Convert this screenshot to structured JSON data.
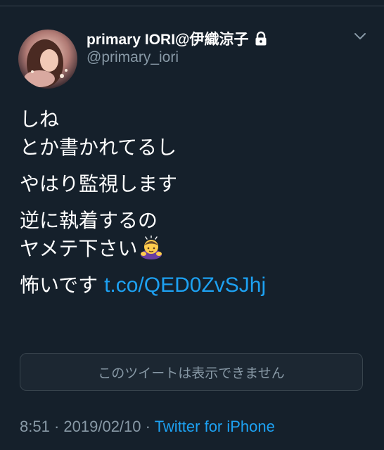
{
  "tweet": {
    "author": {
      "display_name": "primary IORI@伊織涼子",
      "handle": "@primary_iori",
      "protected": true,
      "avatar_caption": "Kiyouko Iori"
    },
    "lines": {
      "p1_l1": "しね",
      "p1_l2": "とか書かれてるし",
      "p2_l1": "やはり監視します",
      "p3_l1": "逆に執着するの",
      "p3_l2": "ヤメテ下さい",
      "p4_text": "怖いです",
      "p4_link": "t.co/QED0ZvSJhj"
    },
    "emoji": "bowing-person-emoji",
    "quoted_unavailable": "このツイートは表示できません",
    "time": "8:51",
    "date": "2019/02/10",
    "separator": "·",
    "source": "Twitter for iPhone"
  },
  "colors": {
    "background": "#15202b",
    "text": "#ffffff",
    "secondary": "#8899a6",
    "link": "#1da1f2",
    "border": "#38444d"
  }
}
